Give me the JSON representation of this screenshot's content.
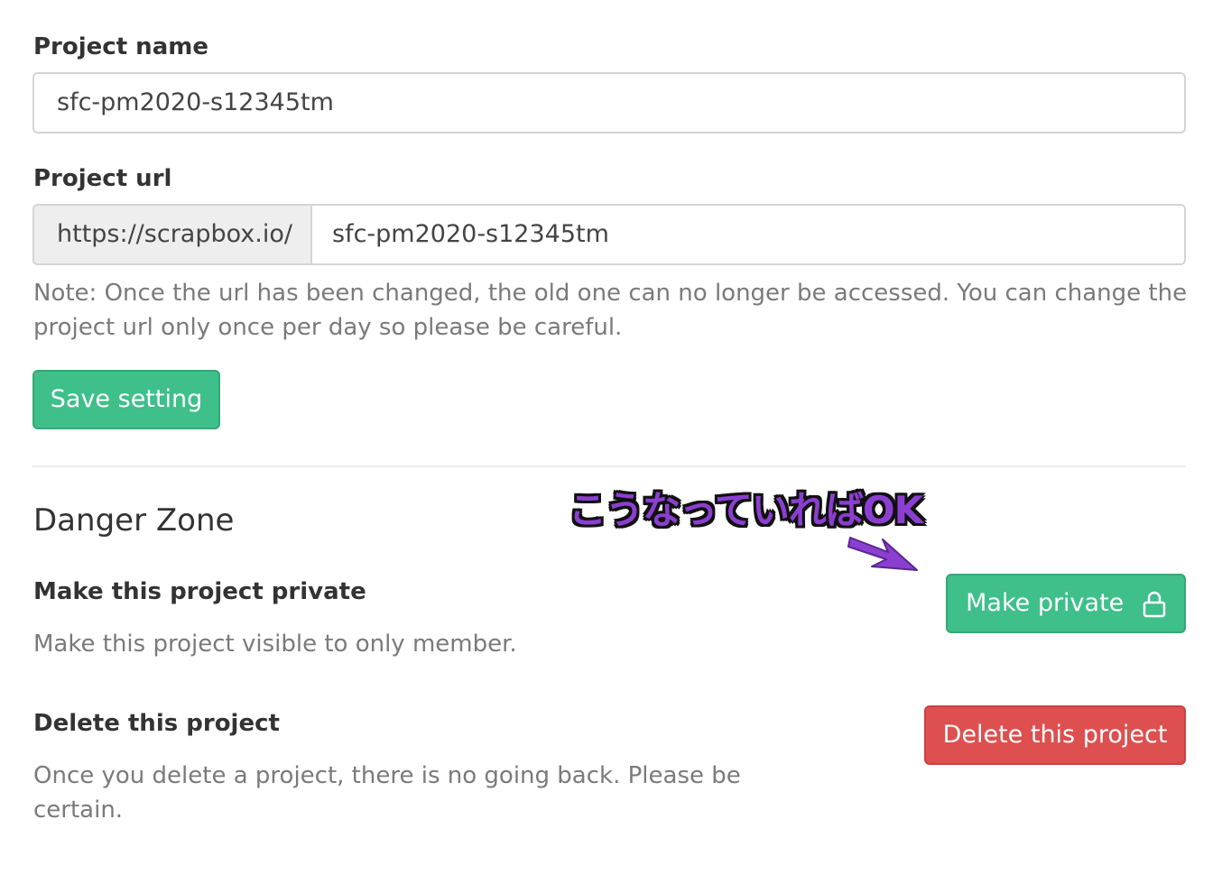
{
  "project_name": {
    "label": "Project name",
    "value": "sfc-pm2020-s12345tm"
  },
  "project_url": {
    "label": "Project url",
    "prefix": "https://scrapbox.io/",
    "value": "sfc-pm2020-s12345tm",
    "note": "Note: Once the url has been changed, the old one can no longer be accessed. You can change the project url only once per day so please be careful."
  },
  "save_button": {
    "label": "Save setting"
  },
  "danger_zone": {
    "title": "Danger Zone",
    "annotation": "こうなっていればOK",
    "make_private": {
      "title": "Make this project private",
      "description": "Make this project visible to only member.",
      "button_label": "Make private",
      "button_icon": "lock-icon"
    },
    "delete_project": {
      "title": "Delete this project",
      "description": "Once you delete a project, there is no going back. Please be certain.",
      "button_label": "Delete this project"
    }
  },
  "colors": {
    "primary_green": "#3fbf8a",
    "danger_red": "#de4f4f",
    "annotation_purple": "#8b3fd0"
  }
}
